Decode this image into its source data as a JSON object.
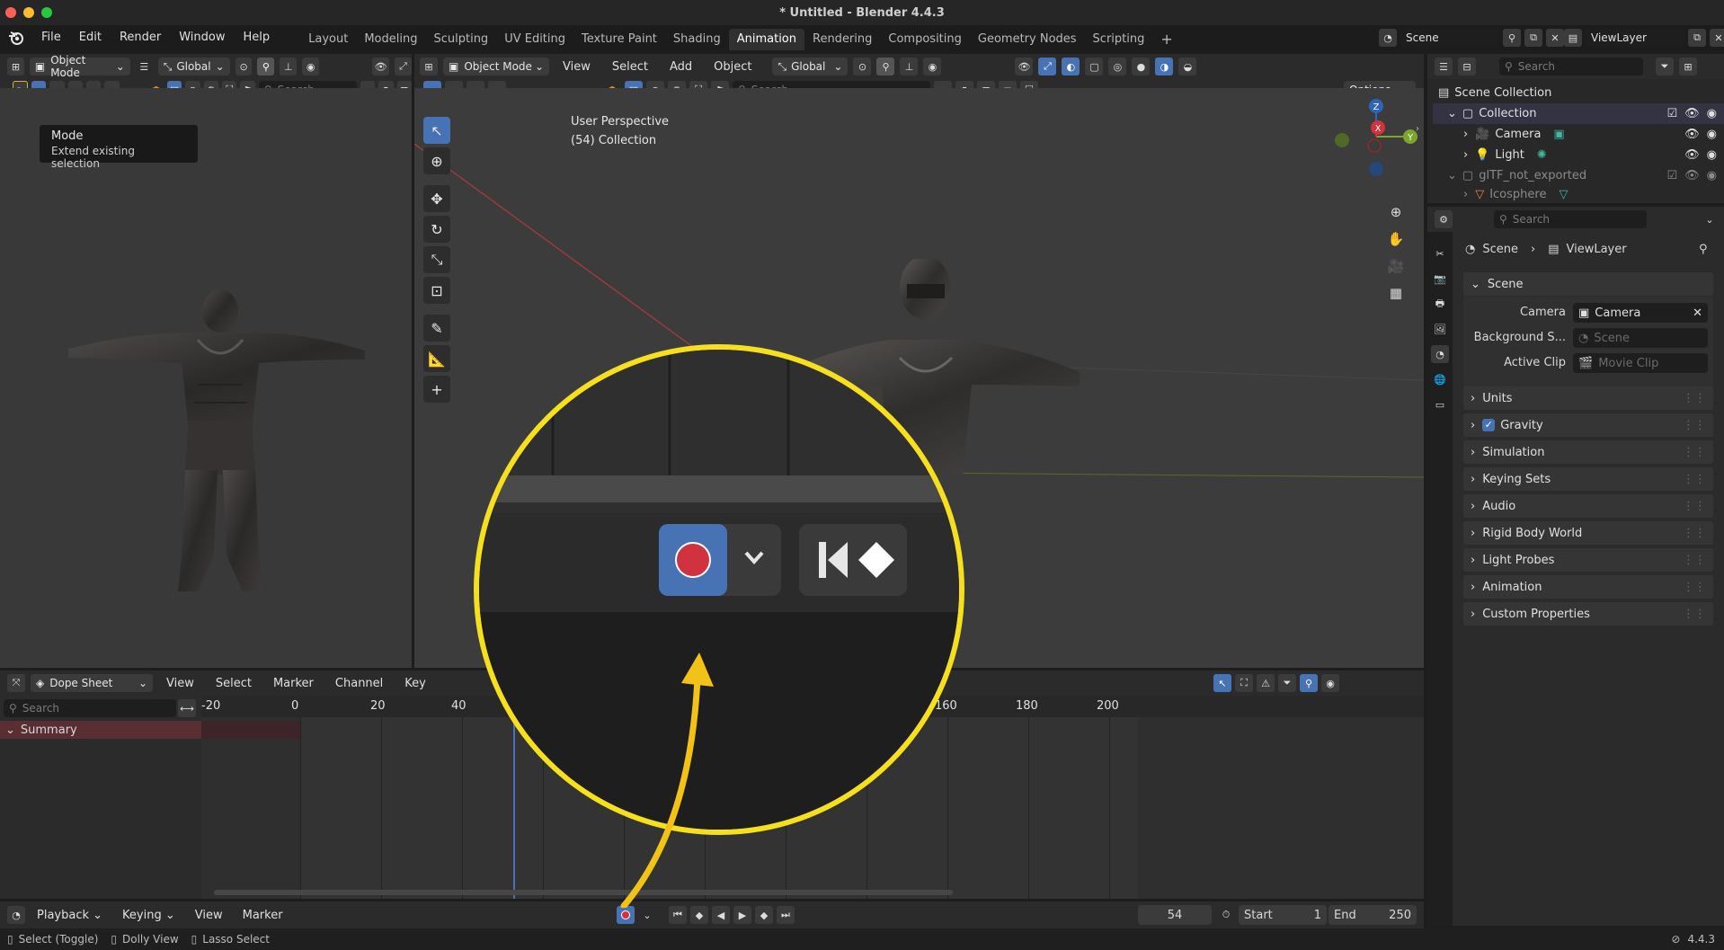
{
  "window": {
    "title": "* Untitled - Blender 4.4.3"
  },
  "menu": {
    "items": [
      "File",
      "Edit",
      "Render",
      "Window",
      "Help"
    ]
  },
  "workspaces": {
    "tabs": [
      "Layout",
      "Modeling",
      "Sculpting",
      "UV Editing",
      "Texture Paint",
      "Shading",
      "Animation",
      "Rendering",
      "Compositing",
      "Geometry Nodes",
      "Scripting"
    ],
    "active": "Animation"
  },
  "top_right": {
    "scene": "Scene",
    "view_layer": "ViewLayer"
  },
  "left_view": {
    "mode": "Object Mode",
    "orientation": "Global",
    "search_placeholder": "Search",
    "tooltip_title": "Mode",
    "tooltip_body": "Extend existing selection"
  },
  "main_view": {
    "mode": "Object Mode",
    "menus": [
      "View",
      "Select",
      "Add",
      "Object"
    ],
    "orientation": "Global",
    "search_placeholder": "Search",
    "options_label": "Options",
    "overlay_line1": "User Perspective",
    "overlay_line2": "(54) Collection",
    "gizmo": {
      "z": "Z",
      "x": "X",
      "y": "Y"
    }
  },
  "outliner": {
    "search_placeholder": "Search",
    "root": "Scene Collection",
    "collection": "Collection",
    "items": [
      "Camera",
      "Light"
    ],
    "second_collection": "glTF_not_exported",
    "second_items": [
      "Icosphere"
    ]
  },
  "properties": {
    "search_placeholder": "Search",
    "breadcrumb_scene": "Scene",
    "breadcrumb_layer": "ViewLayer",
    "scene_panel": "Scene",
    "camera_label": "Camera",
    "camera_value": "Camera",
    "background_label": "Background S...",
    "background_placeholder": "Scene",
    "active_clip_label": "Active Clip",
    "active_clip_placeholder": "Movie Clip",
    "panels": [
      "Units",
      "Gravity",
      "Simulation",
      "Keying Sets",
      "Audio",
      "Rigid Body World",
      "Light Probes",
      "Animation",
      "Custom Properties"
    ]
  },
  "dopesheet": {
    "mode": "Dope Sheet",
    "menus": [
      "View",
      "Select",
      "Marker",
      "Channel",
      "Key"
    ],
    "search_placeholder": "Search",
    "summary": "Summary",
    "ticks": [
      "-20",
      "0",
      "20",
      "40",
      "160",
      "180",
      "200"
    ]
  },
  "timeline": {
    "menus": [
      "Playback",
      "Keying",
      "View",
      "Marker"
    ],
    "current_frame": "54",
    "start_label": "Start",
    "start_value": "1",
    "end_label": "End",
    "end_value": "250"
  },
  "statusbar": {
    "items": [
      "Select (Toggle)",
      "Dolly View",
      "Lasso Select"
    ],
    "version": "4.4.3"
  },
  "colors": {
    "accent": "#4772b3",
    "highlight_ring": "#f5df1e",
    "record": "#d0333f"
  }
}
